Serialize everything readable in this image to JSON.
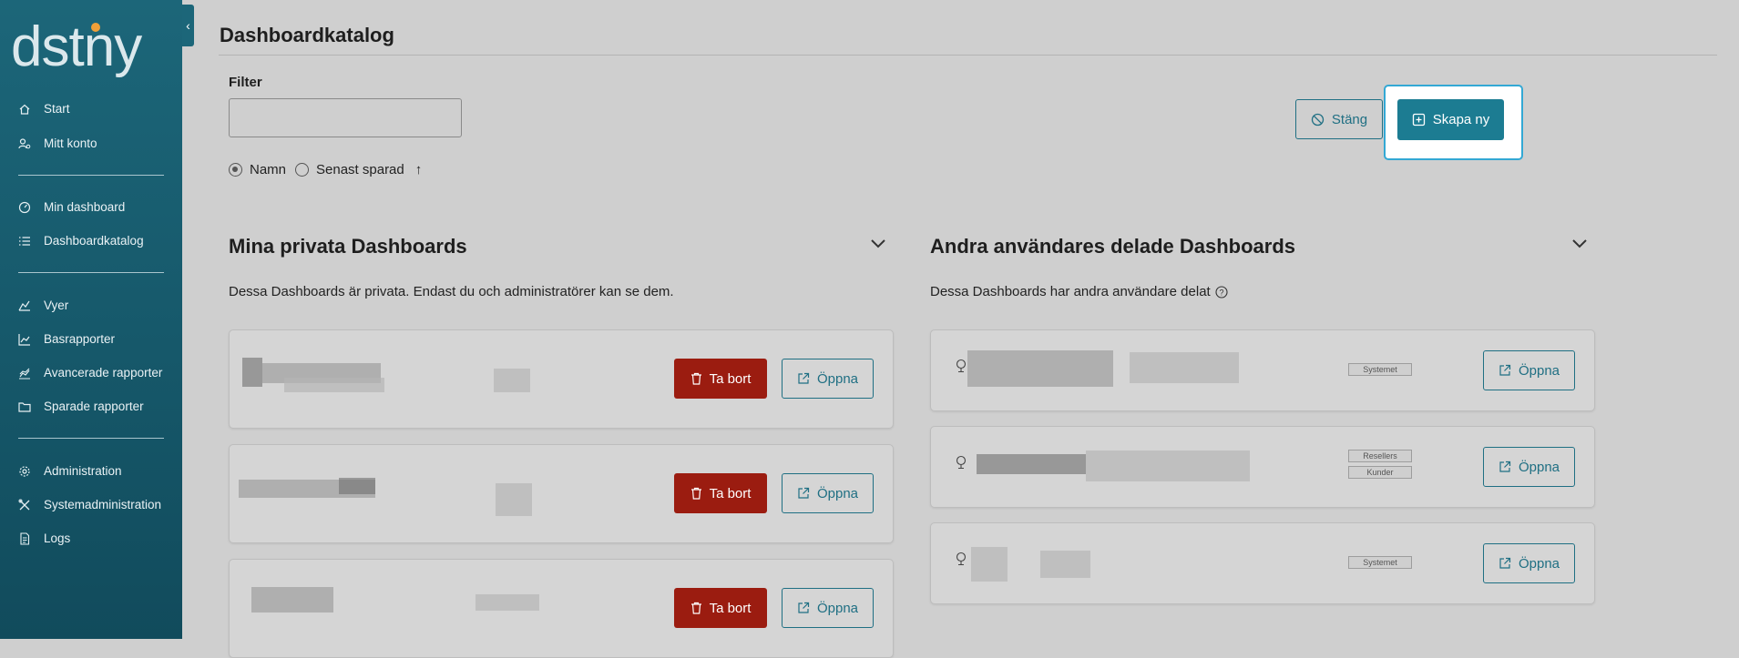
{
  "brand": {
    "name": "dstny"
  },
  "sidebar": {
    "items": [
      {
        "label": "Start",
        "icon": "home-icon"
      },
      {
        "label": "Mitt konto",
        "icon": "user-settings-icon"
      },
      {
        "label": "Min dashboard",
        "icon": "gauge-icon"
      },
      {
        "label": "Dashboardkatalog",
        "icon": "list-icon"
      },
      {
        "label": "Vyer",
        "icon": "chart-area-icon"
      },
      {
        "label": "Basrapporter",
        "icon": "line-chart-icon"
      },
      {
        "label": "Avancerade rapporter",
        "icon": "advanced-chart-icon"
      },
      {
        "label": "Sparade rapporter",
        "icon": "folder-icon"
      },
      {
        "label": "Administration",
        "icon": "gear-icon"
      },
      {
        "label": "Systemadministration",
        "icon": "tools-icon"
      },
      {
        "label": "Logs",
        "icon": "document-icon"
      }
    ]
  },
  "page": {
    "title": "Dashboardkatalog"
  },
  "filter": {
    "label": "Filter",
    "value": "",
    "placeholder": ""
  },
  "sort": {
    "options": [
      "Namn",
      "Senast sparad"
    ],
    "selected": "Namn",
    "direction_icon": "arrow-up-icon"
  },
  "actions": {
    "close_label": "Stäng",
    "create_label": "Skapa ny"
  },
  "private_section": {
    "title": "Mina privata Dashboards",
    "description": "Dessa Dashboards är privata. Endast du och administratörer kan se dem.",
    "delete_label": "Ta bort",
    "open_label": "Öppna",
    "card_count": 3
  },
  "shared_section": {
    "title": "Andra användares delade Dashboards",
    "description": "Dessa Dashboards har andra användare delat",
    "open_label": "Öppna",
    "cards": [
      {
        "tags": [
          "Systemet"
        ]
      },
      {
        "tags": [
          "Resellers",
          "Kunder"
        ]
      },
      {
        "tags": [
          "Systemet"
        ]
      }
    ]
  },
  "colors": {
    "sidebar": "#1c6679",
    "accent": "#1c7c92",
    "danger": "#9b1c10",
    "logo_dot": "#f0a038"
  }
}
